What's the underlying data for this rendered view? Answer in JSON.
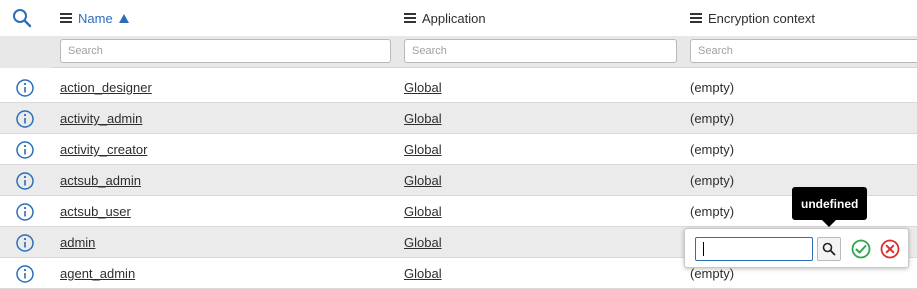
{
  "header": {
    "columns": [
      {
        "label": "Name",
        "sorted": true
      },
      {
        "label": "Application"
      },
      {
        "label": "Encryption context"
      }
    ]
  },
  "filters": {
    "name_placeholder": "Search",
    "app_placeholder": "Search",
    "enc_placeholder": "Search"
  },
  "rows": [
    {
      "name": "action_designer",
      "application": "Global",
      "encryption_context": "(empty)"
    },
    {
      "name": "activity_admin",
      "application": "Global",
      "encryption_context": "(empty)"
    },
    {
      "name": "activity_creator",
      "application": "Global",
      "encryption_context": "(empty)"
    },
    {
      "name": "actsub_admin",
      "application": "Global",
      "encryption_context": "(empty)"
    },
    {
      "name": "actsub_user",
      "application": "Global",
      "encryption_context": "(empty)"
    },
    {
      "name": "admin",
      "application": "Global",
      "encryption_context": ""
    },
    {
      "name": "agent_admin",
      "application": "Global",
      "encryption_context": "(empty)"
    }
  ],
  "inline_editor": {
    "value": "",
    "tooltip": "undefined"
  },
  "colors": {
    "accent": "#2a6ebb",
    "row_alt": "#ebebeb",
    "ok": "#2ea44f",
    "cancel": "#d9302c"
  },
  "icons": {
    "header_search": "search-icon",
    "row_info": "info-icon",
    "lookup": "magnifier-icon",
    "ok": "check-circle-icon",
    "cancel": "x-circle-icon"
  }
}
